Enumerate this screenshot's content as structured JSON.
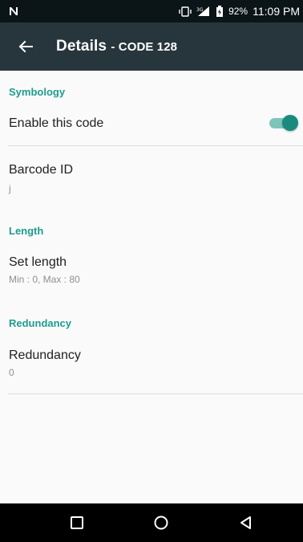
{
  "status_bar": {
    "battery": "92%",
    "time": "11:09 PM",
    "network": "3G"
  },
  "toolbar": {
    "title": "Details",
    "subtitle": "- CODE 128"
  },
  "sections": {
    "symbology": {
      "header": "Symbology",
      "enable_label": "Enable this code",
      "enabled": true
    },
    "barcode_id": {
      "title": "Barcode ID",
      "summary": "j"
    },
    "length": {
      "header": "Length",
      "title": "Set length",
      "summary": "Min : 0, Max : 80"
    },
    "redundancy": {
      "header": "Redundancy",
      "title": "Redundancy",
      "summary": "0"
    }
  },
  "colors": {
    "accent": "#1e9c8f",
    "toolbar": "#27363d",
    "status_bar": "#0b1416"
  },
  "icons": {
    "back": "arrow-left-icon",
    "nav_recent": "square-icon",
    "nav_home": "circle-icon",
    "nav_back": "triangle-icon"
  }
}
